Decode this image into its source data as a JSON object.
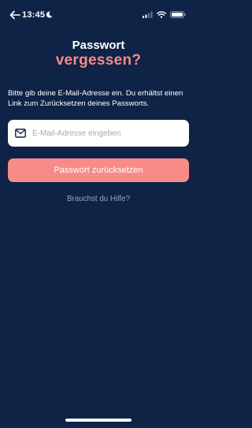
{
  "status_bar": {
    "time": "13:45",
    "icons": [
      "back-arrow-icon",
      "moon-icon",
      "signal-icon",
      "wifi-icon",
      "battery-icon"
    ]
  },
  "header": {
    "title_line1": "Passwort",
    "title_line2": "vergessen?"
  },
  "description": "Bitte gib deine E-Mail-Adresse ein. Du erhältst einen Link zum Zurücksetzen deines Passworts.",
  "email": {
    "placeholder": "E-Mail-Adresse eingeben",
    "value": "",
    "icon": "mail-icon"
  },
  "reset_button": {
    "label": "Passwort zurücksetzen"
  },
  "help_link": {
    "label": "Brauchst du Hilfe?"
  },
  "colors": {
    "background": "#0f2347",
    "accent": "#f78b87",
    "muted_text": "#9aa3b6",
    "field_bg": "#ffffff"
  }
}
